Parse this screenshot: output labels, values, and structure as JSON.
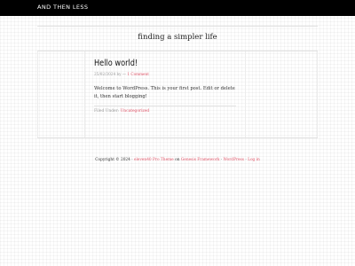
{
  "header": {
    "site_title": "AND THEN LESS",
    "tagline": "finding a simpler life"
  },
  "post": {
    "title": "Hello world!",
    "date": "25/02/2024 by",
    "comments": "1 Comment",
    "content": "Welcome to WordPress. This is your first post. Edit or delete it, then start blogging!",
    "filed_under_label": "Filed Under:",
    "category": "Uncategorized"
  },
  "footer": {
    "copyright": "Copyright © 2024 ·",
    "theme": "eleven40 Pro Theme",
    "on": "on",
    "framework": "Genesis Framework",
    "sep1": "·",
    "wordpress": "WordPress",
    "sep2": "·",
    "login": "Log in"
  },
  "colors": {
    "topbar": "#000000",
    "accent": "#e0576a"
  }
}
